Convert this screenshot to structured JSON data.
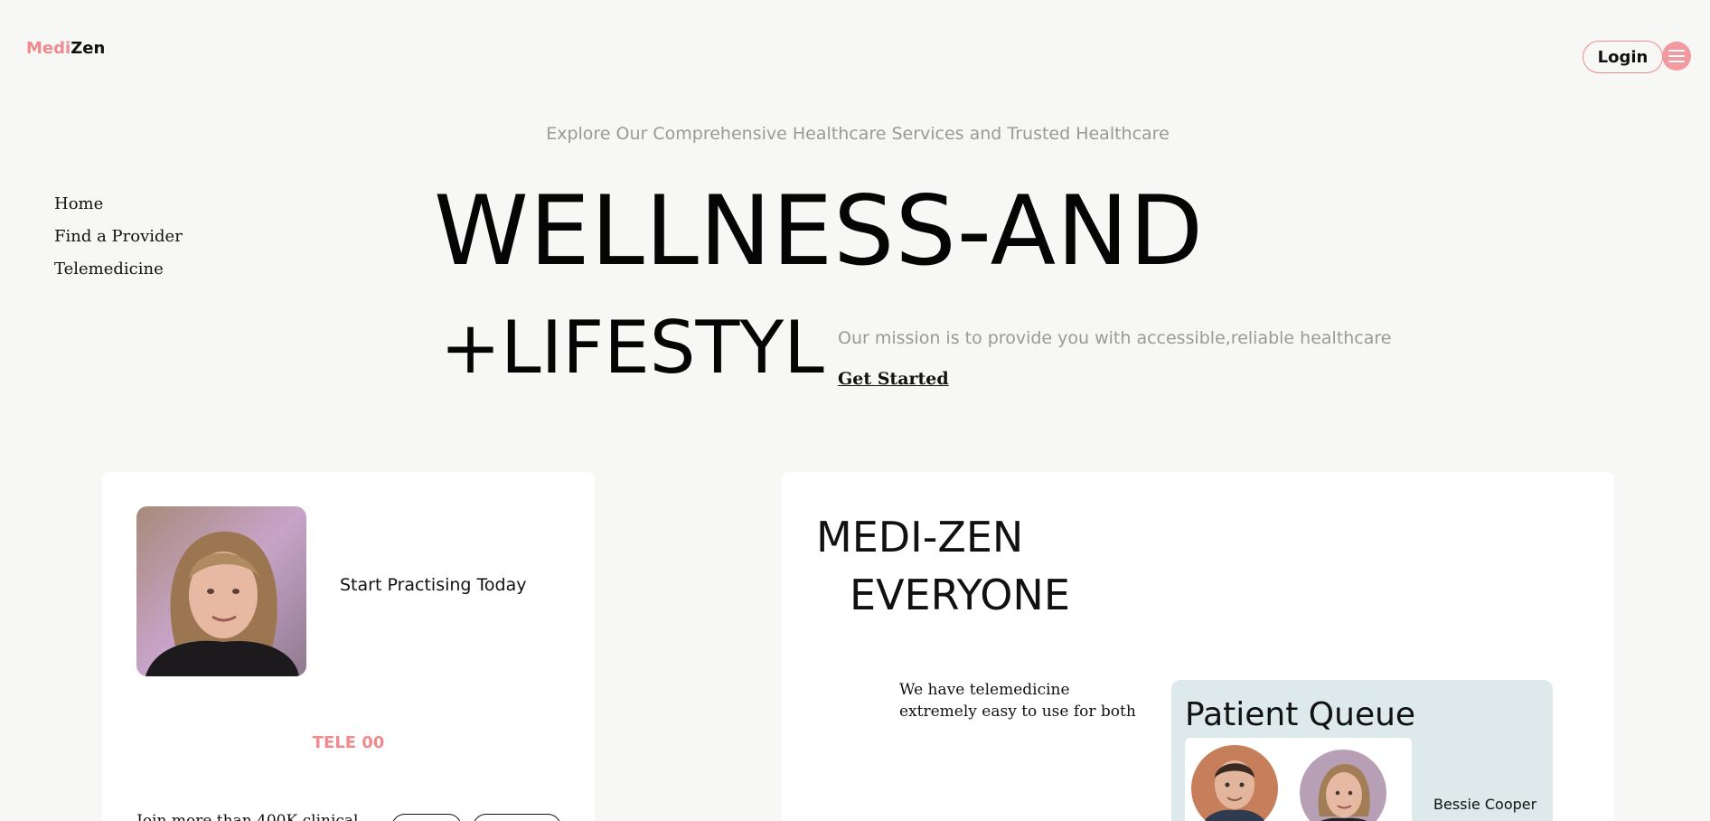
{
  "brand": {
    "part1": "Medi",
    "part2": "Zen",
    "accent": "#f08a8e"
  },
  "header": {
    "login_label": "Login"
  },
  "tagline": "Explore Our Comprehensive Healthcare Services and Trusted Healthcare",
  "sidebar": {
    "items": [
      {
        "label": "Home"
      },
      {
        "label": "Find a Provider"
      },
      {
        "label": "Telemedicine"
      }
    ]
  },
  "hero": {
    "line1": "WELLNESS-AND",
    "line2": "+LIFESTYL",
    "mission": "Our mission is to provide you with accessible,reliable healthcare",
    "cta": "Get Started"
  },
  "card_left": {
    "heading": "Start Practising Today",
    "stat": "TELE 00",
    "join_text": "Join more than 400K clinical"
  },
  "card_right": {
    "title_line1": "MEDI-ZEN",
    "title_line2": "EVERYONE",
    "telemedicine_line1": "We have telemedicine",
    "telemedicine_line2": "extremely easy to use for both",
    "queue": {
      "title": "Patient Queue",
      "patient_name": "Bessie Cooper"
    }
  }
}
